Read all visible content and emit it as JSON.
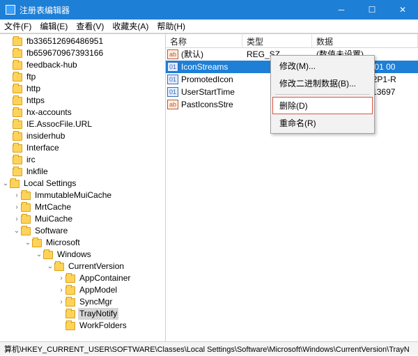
{
  "window": {
    "title": "注册表编辑器"
  },
  "menu": {
    "file": "文件(F)",
    "edit": "编辑(E)",
    "view": "查看(V)",
    "fav": "收藏夹(A)",
    "help": "帮助(H)"
  },
  "tree": {
    "n0": "fb336512696486951",
    "n1": "fb659670967393166",
    "n2": "feedback-hub",
    "n3": "ftp",
    "n4": "http",
    "n5": "https",
    "n6": "hx-accounts",
    "n7": "IE.AssocFile.URL",
    "n8": "insiderhub",
    "n9": "Interface",
    "n10": "irc",
    "n11": "lnkfile",
    "n12": "Local Settings",
    "n13": "ImmutableMuiCache",
    "n14": "MrtCache",
    "n15": "MuiCache",
    "n16": "Software",
    "n17": "Microsoft",
    "n18": "Windows",
    "n19": "CurrentVersion",
    "n20": "AppContainer",
    "n21": "AppModel",
    "n22": "SyncMgr",
    "n23": "TrayNotify",
    "n24": "WorkFolders"
  },
  "headers": {
    "name": "名称",
    "type": "类型",
    "data": "数据"
  },
  "rows": [
    {
      "icon": "str",
      "name": "(默认)",
      "type": "REG_SZ",
      "data": "(数值未设置)"
    },
    {
      "icon": "bin",
      "name": "IconStreams",
      "type": "",
      "data": "00 07 00 00 00 01 00"
    },
    {
      "icon": "bin",
      "name": "PromotedIcon",
      "type": "",
      "data": "5-23R3-4229-82P1-R"
    },
    {
      "icon": "bin",
      "name": "UserStartTime",
      "type": "",
      "data": "3b36c9d34 (1313697"
    },
    {
      "icon": "str",
      "name": "PastIconsStre",
      "type": "",
      "data": ""
    }
  ],
  "ctx": {
    "modify": "修改(M)...",
    "modbin": "修改二进制数据(B)...",
    "delete": "删除(D)",
    "rename": "重命名(R)"
  },
  "status": {
    "path": "算机\\HKEY_CURRENT_USER\\SOFTWARE\\Classes\\Local Settings\\Software\\Microsoft\\Windows\\CurrentVersion\\TrayN"
  }
}
